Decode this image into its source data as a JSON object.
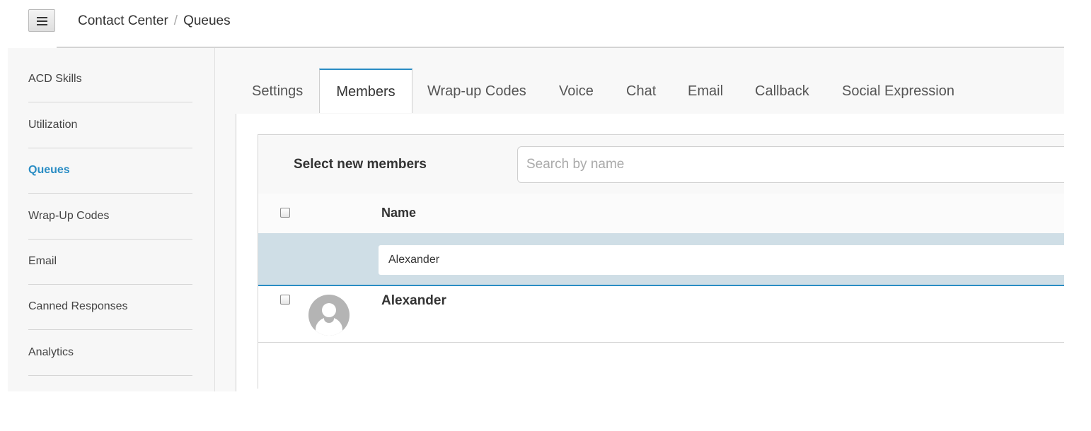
{
  "breadcrumb": {
    "parent": "Contact Center",
    "separator": "/",
    "current": "Queues"
  },
  "menu_button": {
    "icon": "hamburger-menu-icon"
  },
  "sidebar": {
    "items": [
      {
        "label": "ACD Skills"
      },
      {
        "label": "Utilization"
      },
      {
        "label": "Queues",
        "active": true
      },
      {
        "label": "Wrap-Up Codes"
      },
      {
        "label": "Email"
      },
      {
        "label": "Canned Responses"
      },
      {
        "label": "Analytics"
      }
    ]
  },
  "tabs": [
    {
      "label": "Settings"
    },
    {
      "label": "Members",
      "active": true
    },
    {
      "label": "Wrap-up Codes"
    },
    {
      "label": "Voice"
    },
    {
      "label": "Chat"
    },
    {
      "label": "Email"
    },
    {
      "label": "Callback"
    },
    {
      "label": "Social Expression"
    }
  ],
  "members": {
    "select_label": "Select new members",
    "search_placeholder": "Search by name",
    "search_value": "",
    "columns": {
      "name": "Name"
    },
    "filter_value": "Alexander",
    "rows": [
      {
        "name": "Alexander",
        "checked": false
      }
    ]
  },
  "colors": {
    "accent": "#2a8dc4",
    "filter_row_bg": "#cfdee6",
    "avatar_bg": "#b4b4b4"
  }
}
